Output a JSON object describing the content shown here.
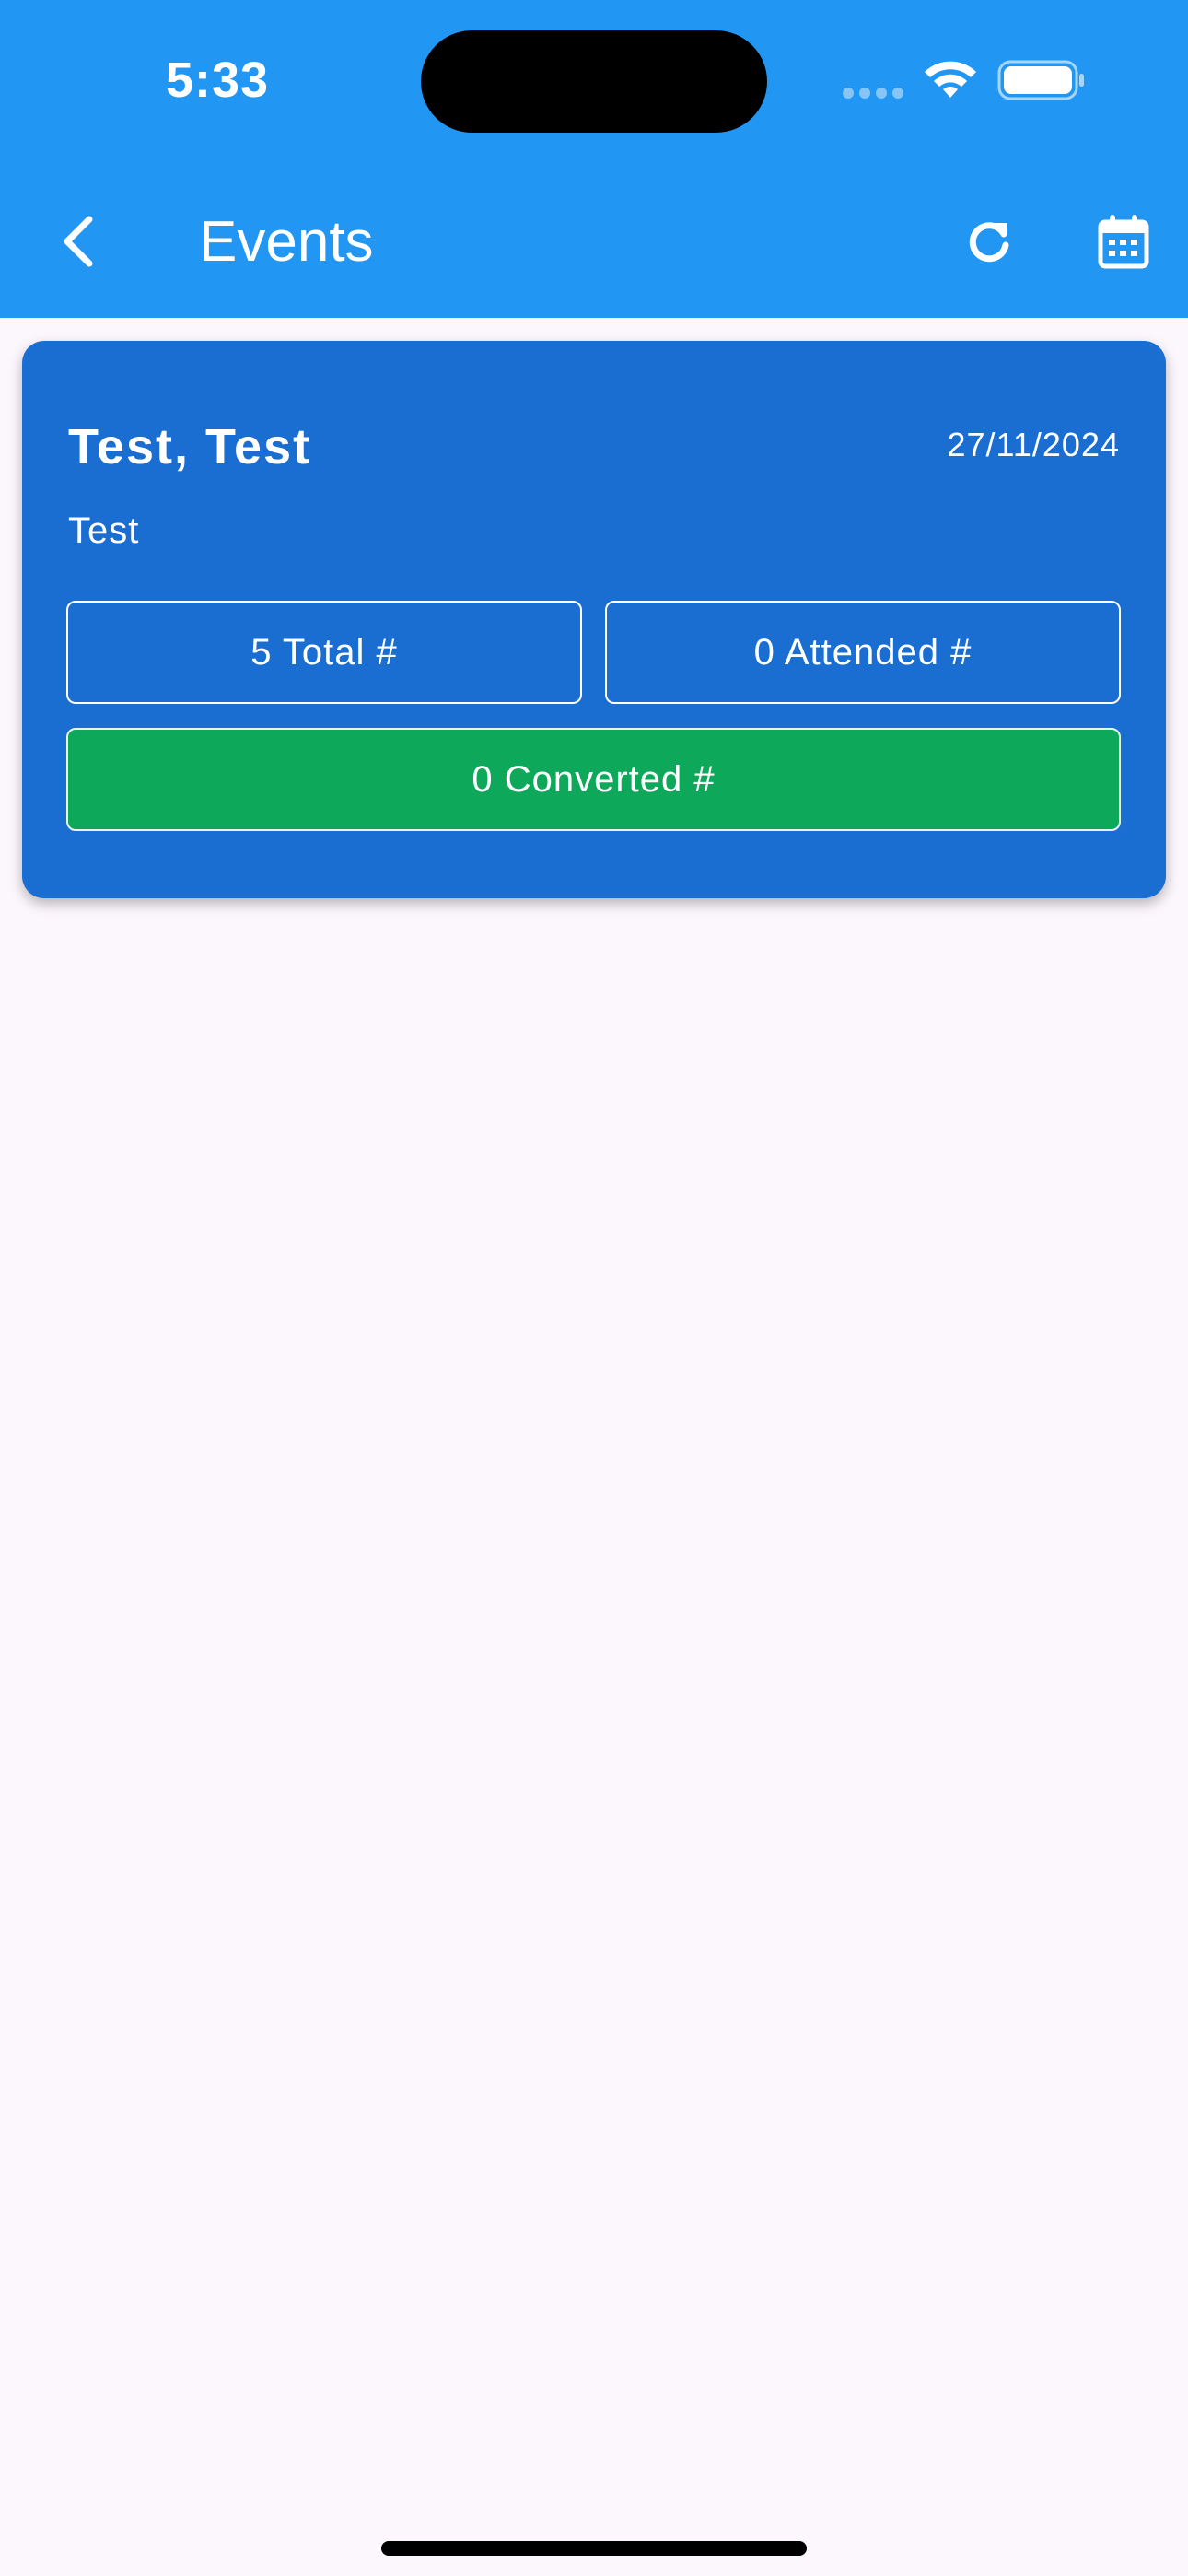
{
  "status_bar": {
    "time": "5:33"
  },
  "header": {
    "title": "Events",
    "back_icon": "chevron-left-icon",
    "refresh_icon": "refresh-icon",
    "calendar_icon": "calendar-icon"
  },
  "colors": {
    "header_bg": "#2196F3",
    "card_bg": "#1A6ED2",
    "converted_bg": "#0DA85A",
    "page_bg": "#FCF7FD"
  },
  "events": [
    {
      "name": "Test, Test",
      "date": "27/11/2024",
      "description": "Test",
      "total_label": "5 Total #",
      "attended_label": "0 Attended #",
      "converted_label": "0 Converted #"
    }
  ]
}
